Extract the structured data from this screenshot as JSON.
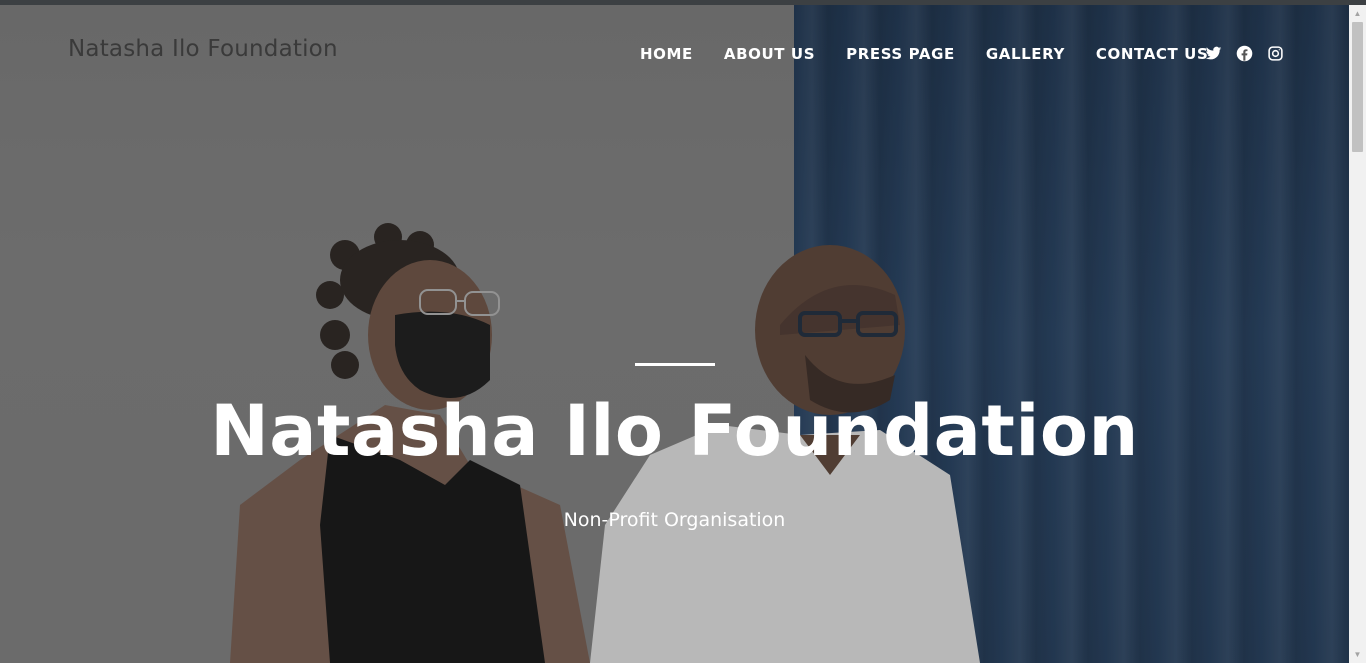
{
  "site": {
    "title": "Natasha Ilo Foundation"
  },
  "nav": {
    "items": [
      {
        "label": "HOME"
      },
      {
        "label": "ABOUT US"
      },
      {
        "label": "PRESS PAGE"
      },
      {
        "label": "GALLERY"
      },
      {
        "label": "CONTACT US"
      }
    ]
  },
  "social": {
    "icons": [
      "twitter-icon",
      "facebook-icon",
      "instagram-icon"
    ]
  },
  "hero": {
    "title": "Natasha Ilo Foundation",
    "subtitle": "Non-Profit Organisation"
  },
  "colors": {
    "curtain": "#233d5c",
    "wall": "#7a7a7a",
    "text": "#ffffff",
    "site_title": "#3a3a3a"
  }
}
